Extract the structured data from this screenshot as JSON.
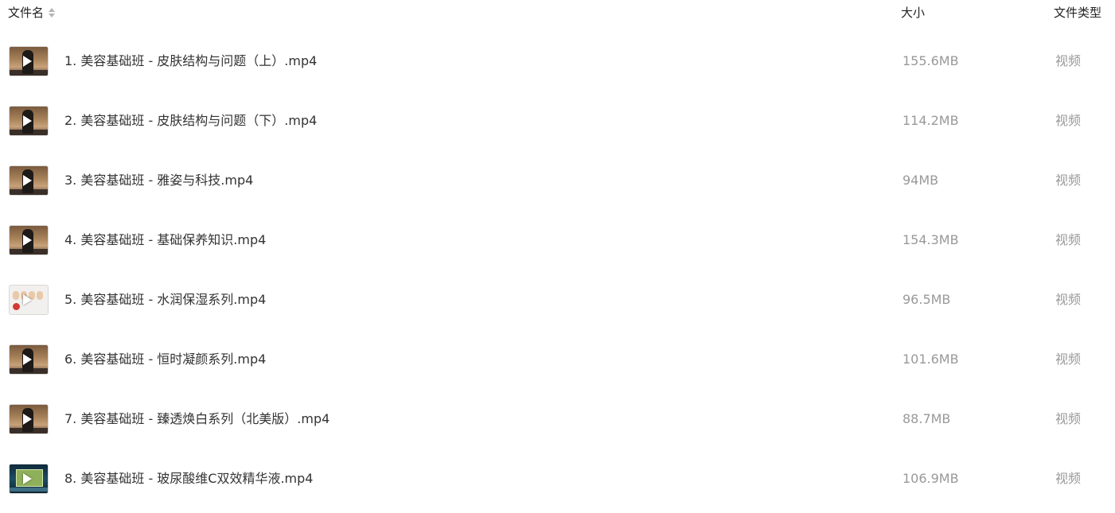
{
  "header": {
    "name_label": "文件名",
    "size_label": "大小",
    "type_label": "文件类型",
    "sort_icon": "sort-icon"
  },
  "files": [
    {
      "name": "1. 美容基础班 - 皮肤结构与问题（上）.mp4",
      "size": "155.6MB",
      "type": "视频",
      "thumb": "stage"
    },
    {
      "name": "2. 美容基础班 - 皮肤结构与问题（下）.mp4",
      "size": "114.2MB",
      "type": "视频",
      "thumb": "stage"
    },
    {
      "name": "3. 美容基础班 - 雅姿与科技.mp4",
      "size": "94MB",
      "type": "视频",
      "thumb": "stage"
    },
    {
      "name": "4. 美容基础班 - 基础保养知识.mp4",
      "size": "154.3MB",
      "type": "视频",
      "thumb": "stage"
    },
    {
      "name": "5. 美容基础班 - 水润保湿系列.mp4",
      "size": "96.5MB",
      "type": "视频",
      "thumb": "faces"
    },
    {
      "name": "6. 美容基础班 - 恒时凝颜系列.mp4",
      "size": "101.6MB",
      "type": "视频",
      "thumb": "stage"
    },
    {
      "name": "7. 美容基础班 - 臻透焕白系列（北美版）.mp4",
      "size": "88.7MB",
      "type": "视频",
      "thumb": "stage"
    },
    {
      "name": "8. 美容基础班 - 玻尿酸维C双效精华液.mp4",
      "size": "106.9MB",
      "type": "视频",
      "thumb": "screen"
    }
  ],
  "icons": {
    "play": "play-icon",
    "video_thumb": "video-thumbnail"
  }
}
